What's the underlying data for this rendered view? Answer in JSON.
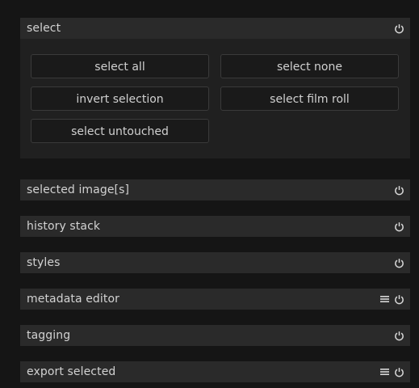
{
  "modules": [
    {
      "label": "select",
      "presets": false
    },
    {
      "label": "selected image[s]",
      "presets": false
    },
    {
      "label": "history stack",
      "presets": false
    },
    {
      "label": "styles",
      "presets": false
    },
    {
      "label": "metadata editor",
      "presets": true
    },
    {
      "label": "tagging",
      "presets": false
    },
    {
      "label": "export selected",
      "presets": true
    }
  ],
  "select_buttons": {
    "select_all": "select all",
    "select_none": "select none",
    "invert_selection": "invert selection",
    "select_film_roll": "select film roll",
    "select_untouched": "select untouched"
  },
  "colors": {
    "panel_background": "#151515",
    "module_header": "#2a2a2a",
    "module_body": "#202020",
    "button_background": "#1a1a1a",
    "text": "#d0d0d0"
  }
}
